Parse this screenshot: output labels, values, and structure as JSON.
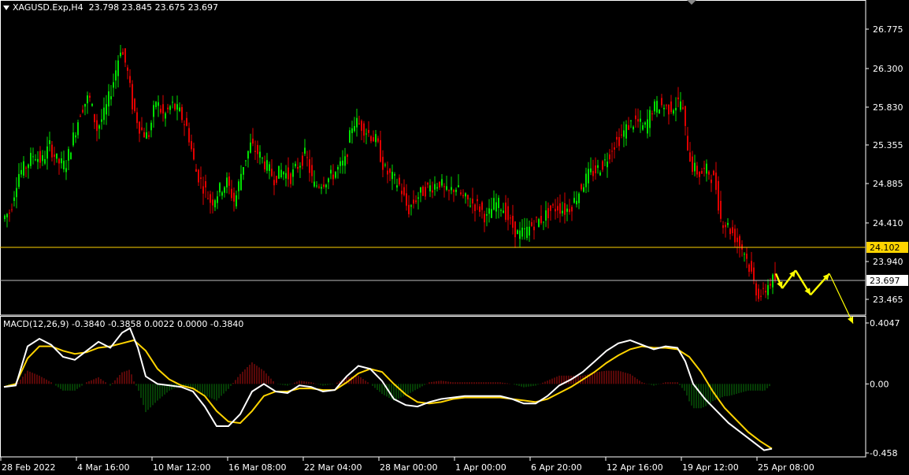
{
  "header": {
    "symbol": "XAGUSD.Exp,H4",
    "ohlc": "23.798 23.845 23.675 23.697"
  },
  "macd_header": {
    "label": "MACD(12,26,9)",
    "values": "-0.3840 -0.3858 0.0022 0.0000 -0.3840"
  },
  "colors": {
    "background": "#000000",
    "bull": "#00e000",
    "bear": "#e00000",
    "signal_line": "#ffd400",
    "macd_line": "#ffffff",
    "grid_line": "#ffffff",
    "level_line": "#ffd400",
    "forecast": "#ffff00"
  },
  "chart_data": [
    {
      "type": "candlestick",
      "symbol": "XAGUSD.Exp",
      "timeframe": "H4",
      "y_ticks": [
        "26.775",
        "26.300",
        "25.830",
        "25.355",
        "24.885",
        "24.410",
        "23.940",
        "23.465"
      ],
      "ylim": [
        23.18,
        27.0
      ],
      "x_ticks": [
        "28 Feb 2022",
        "4 Mar 16:00",
        "10 Mar 12:00",
        "16 Mar 08:00",
        "22 Mar 04:00",
        "28 Mar 00:00",
        "1 Apr 00:00",
        "6 Apr 20:00",
        "12 Apr 16:00",
        "19 Apr 12:00",
        "25 Apr 08:00"
      ],
      "price_path": [
        [
          0,
          24.45
        ],
        [
          10,
          24.55
        ],
        [
          20,
          25.0
        ],
        [
          30,
          25.1
        ],
        [
          40,
          25.25
        ],
        [
          50,
          25.15
        ],
        [
          60,
          25.35
        ],
        [
          70,
          25.15
        ],
        [
          80,
          25.1
        ],
        [
          90,
          25.45
        ],
        [
          100,
          25.8
        ],
        [
          110,
          25.95
        ],
        [
          120,
          25.55
        ],
        [
          130,
          25.75
        ],
        [
          140,
          26.1
        ],
        [
          150,
          26.55
        ],
        [
          158,
          26.3
        ],
        [
          165,
          25.85
        ],
        [
          175,
          25.55
        ],
        [
          185,
          25.45
        ],
        [
          195,
          25.9
        ],
        [
          205,
          25.7
        ],
        [
          215,
          25.85
        ],
        [
          225,
          25.75
        ],
        [
          235,
          25.55
        ],
        [
          245,
          25.05
        ],
        [
          255,
          24.85
        ],
        [
          265,
          24.65
        ],
        [
          275,
          24.8
        ],
        [
          285,
          24.9
        ],
        [
          295,
          24.65
        ],
        [
          305,
          25.1
        ],
        [
          315,
          25.35
        ],
        [
          325,
          25.25
        ],
        [
          335,
          25.1
        ],
        [
          345,
          24.95
        ],
        [
          355,
          25.05
        ],
        [
          365,
          24.95
        ],
        [
          375,
          25.1
        ],
        [
          385,
          25.25
        ],
        [
          395,
          24.85
        ],
        [
          405,
          24.9
        ],
        [
          415,
          24.95
        ],
        [
          425,
          25.05
        ],
        [
          435,
          25.15
        ],
        [
          445,
          25.65
        ],
        [
          455,
          25.6
        ],
        [
          465,
          25.5
        ],
        [
          475,
          25.4
        ],
        [
          485,
          25.05
        ],
        [
          495,
          24.95
        ],
        [
          505,
          24.85
        ],
        [
          515,
          24.55
        ],
        [
          525,
          24.7
        ],
        [
          535,
          24.8
        ],
        [
          545,
          24.85
        ],
        [
          555,
          24.9
        ],
        [
          565,
          24.75
        ],
        [
          575,
          24.85
        ],
        [
          585,
          24.7
        ],
        [
          595,
          24.65
        ],
        [
          605,
          24.6
        ],
        [
          615,
          24.45
        ],
        [
          625,
          24.65
        ],
        [
          635,
          24.6
        ],
        [
          645,
          24.4
        ],
        [
          655,
          24.25
        ],
        [
          665,
          24.3
        ],
        [
          675,
          24.4
        ],
        [
          685,
          24.45
        ],
        [
          695,
          24.55
        ],
        [
          705,
          24.6
        ],
        [
          715,
          24.55
        ],
        [
          725,
          24.65
        ],
        [
          735,
          24.85
        ],
        [
          745,
          25.0
        ],
        [
          755,
          25.05
        ],
        [
          765,
          25.15
        ],
        [
          775,
          25.35
        ],
        [
          785,
          25.45
        ],
        [
          795,
          25.6
        ],
        [
          805,
          25.65
        ],
        [
          815,
          25.55
        ],
        [
          825,
          25.8
        ],
        [
          835,
          25.85
        ],
        [
          845,
          25.8
        ],
        [
          855,
          25.85
        ],
        [
          862,
          25.9
        ],
        [
          868,
          25.45
        ],
        [
          875,
          25.1
        ],
        [
          885,
          25.0
        ],
        [
          895,
          25.05
        ],
        [
          905,
          24.9
        ],
        [
          912,
          24.45
        ],
        [
          922,
          24.35
        ],
        [
          932,
          24.2
        ],
        [
          942,
          24.05
        ],
        [
          950,
          23.8
        ],
        [
          958,
          23.55
        ],
        [
          965,
          23.5
        ],
        [
          972,
          23.65
        ],
        [
          978,
          23.7
        ]
      ],
      "levels": [
        {
          "label": "24.102",
          "value": 24.102,
          "style": "yellow"
        },
        {
          "label": "23.697",
          "value": 23.697,
          "style": "white"
        }
      ],
      "forecast_path": [
        [
          980,
          23.78
        ],
        [
          988,
          23.6
        ],
        [
          1005,
          23.82
        ],
        [
          1024,
          23.52
        ],
        [
          1048,
          23.78
        ],
        [
          1078,
          23.17
        ]
      ]
    },
    {
      "type": "macd",
      "params": [
        12,
        26,
        9
      ],
      "y_ticks": [
        "0.4047",
        "0.00",
        "-0.458"
      ],
      "ylim": [
        -0.458,
        0.4047
      ],
      "macd_line": [
        [
          0,
          -0.02
        ],
        [
          15,
          -0.01
        ],
        [
          30,
          0.25
        ],
        [
          45,
          0.3
        ],
        [
          60,
          0.26
        ],
        [
          75,
          0.18
        ],
        [
          90,
          0.16
        ],
        [
          105,
          0.22
        ],
        [
          120,
          0.28
        ],
        [
          135,
          0.24
        ],
        [
          150,
          0.34
        ],
        [
          160,
          0.37
        ],
        [
          170,
          0.24
        ],
        [
          180,
          0.05
        ],
        [
          195,
          0.0
        ],
        [
          210,
          -0.01
        ],
        [
          225,
          -0.02
        ],
        [
          240,
          -0.05
        ],
        [
          255,
          -0.15
        ],
        [
          270,
          -0.28
        ],
        [
          285,
          -0.28
        ],
        [
          300,
          -0.2
        ],
        [
          315,
          -0.05
        ],
        [
          330,
          0.0
        ],
        [
          345,
          -0.05
        ],
        [
          360,
          -0.06
        ],
        [
          375,
          -0.01
        ],
        [
          390,
          -0.02
        ],
        [
          405,
          -0.05
        ],
        [
          420,
          -0.04
        ],
        [
          435,
          0.05
        ],
        [
          450,
          0.12
        ],
        [
          465,
          0.1
        ],
        [
          480,
          0.02
        ],
        [
          495,
          -0.1
        ],
        [
          510,
          -0.14
        ],
        [
          525,
          -0.15
        ],
        [
          540,
          -0.12
        ],
        [
          555,
          -0.1
        ],
        [
          570,
          -0.09
        ],
        [
          585,
          -0.08
        ],
        [
          600,
          -0.08
        ],
        [
          615,
          -0.08
        ],
        [
          630,
          -0.08
        ],
        [
          645,
          -0.1
        ],
        [
          660,
          -0.13
        ],
        [
          675,
          -0.13
        ],
        [
          690,
          -0.08
        ],
        [
          705,
          -0.01
        ],
        [
          720,
          0.03
        ],
        [
          735,
          0.08
        ],
        [
          750,
          0.15
        ],
        [
          765,
          0.22
        ],
        [
          780,
          0.27
        ],
        [
          795,
          0.29
        ],
        [
          810,
          0.26
        ],
        [
          825,
          0.23
        ],
        [
          840,
          0.25
        ],
        [
          855,
          0.24
        ],
        [
          865,
          0.15
        ],
        [
          875,
          0.0
        ],
        [
          890,
          -0.1
        ],
        [
          905,
          -0.18
        ],
        [
          920,
          -0.26
        ],
        [
          935,
          -0.32
        ],
        [
          950,
          -0.38
        ],
        [
          965,
          -0.44
        ],
        [
          975,
          -0.43
        ]
      ],
      "signal_line": [
        [
          0,
          -0.02
        ],
        [
          15,
          0.0
        ],
        [
          30,
          0.17
        ],
        [
          45,
          0.25
        ],
        [
          60,
          0.25
        ],
        [
          75,
          0.22
        ],
        [
          90,
          0.2
        ],
        [
          105,
          0.21
        ],
        [
          120,
          0.24
        ],
        [
          135,
          0.25
        ],
        [
          150,
          0.27
        ],
        [
          165,
          0.29
        ],
        [
          180,
          0.22
        ],
        [
          195,
          0.1
        ],
        [
          210,
          0.03
        ],
        [
          225,
          -0.01
        ],
        [
          240,
          -0.03
        ],
        [
          255,
          -0.08
        ],
        [
          270,
          -0.18
        ],
        [
          285,
          -0.25
        ],
        [
          300,
          -0.26
        ],
        [
          315,
          -0.18
        ],
        [
          330,
          -0.08
        ],
        [
          345,
          -0.05
        ],
        [
          360,
          -0.05
        ],
        [
          375,
          -0.03
        ],
        [
          390,
          -0.03
        ],
        [
          405,
          -0.04
        ],
        [
          420,
          -0.04
        ],
        [
          435,
          0.01
        ],
        [
          450,
          0.07
        ],
        [
          465,
          0.1
        ],
        [
          480,
          0.08
        ],
        [
          495,
          0.0
        ],
        [
          510,
          -0.07
        ],
        [
          525,
          -0.12
        ],
        [
          540,
          -0.13
        ],
        [
          555,
          -0.12
        ],
        [
          570,
          -0.1
        ],
        [
          585,
          -0.09
        ],
        [
          600,
          -0.09
        ],
        [
          615,
          -0.09
        ],
        [
          630,
          -0.09
        ],
        [
          645,
          -0.1
        ],
        [
          660,
          -0.11
        ],
        [
          675,
          -0.12
        ],
        [
          690,
          -0.1
        ],
        [
          705,
          -0.06
        ],
        [
          720,
          -0.02
        ],
        [
          735,
          0.03
        ],
        [
          750,
          0.08
        ],
        [
          765,
          0.14
        ],
        [
          780,
          0.19
        ],
        [
          795,
          0.23
        ],
        [
          810,
          0.25
        ],
        [
          825,
          0.24
        ],
        [
          840,
          0.24
        ],
        [
          855,
          0.23
        ],
        [
          870,
          0.18
        ],
        [
          885,
          0.08
        ],
        [
          900,
          -0.05
        ],
        [
          915,
          -0.16
        ],
        [
          930,
          -0.24
        ],
        [
          945,
          -0.32
        ],
        [
          960,
          -0.38
        ],
        [
          975,
          -0.43
        ]
      ]
    }
  ]
}
